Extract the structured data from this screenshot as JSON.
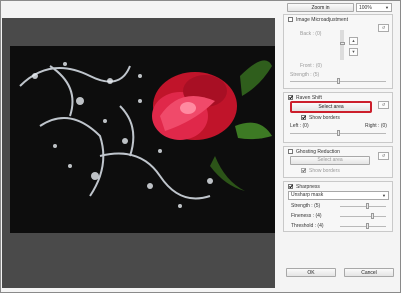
{
  "toolbar": {
    "zoom_button": "Zoom in",
    "zoom_level": "100%"
  },
  "micro": {
    "title": "Image Microadjustment",
    "back": "Back : (0)",
    "front": "Front : (0)",
    "strength": "Strength : (5)",
    "checked": false
  },
  "raven": {
    "title": "Raven Shift",
    "select_area": "Select area",
    "show_borders": "Show borders",
    "left": "Left : (0)",
    "right": "Right : (0)",
    "checked": true,
    "show_borders_checked": true
  },
  "ghost": {
    "title": "Ghosting Reduction",
    "select_area": "Select area",
    "show_borders": "Show borders",
    "checked": false,
    "show_borders_checked": true
  },
  "sharp": {
    "title": "Sharpness",
    "mode": "Unsharp mask",
    "strength": "Strength : (5)",
    "fineness": "Fineness : (4)",
    "threshold": "Threshold : (4)",
    "checked": true
  },
  "footer": {
    "ok": "OK",
    "cancel": "Cancel"
  },
  "colors": {
    "highlight": "#cc1f2c"
  }
}
